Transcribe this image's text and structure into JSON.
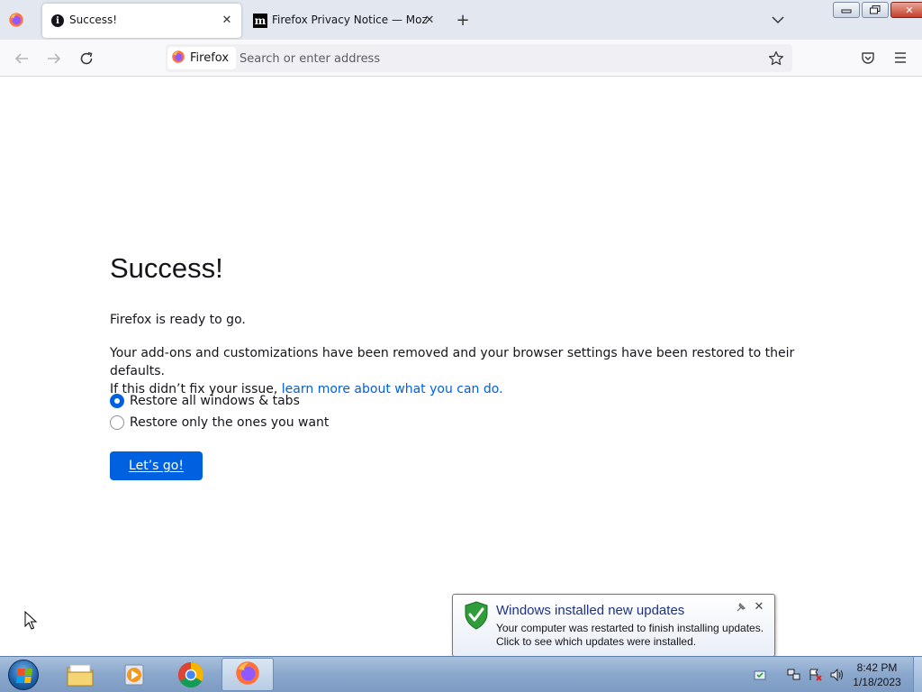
{
  "browser": {
    "tabs": [
      {
        "label": "Success!",
        "favicon": "info-icon",
        "active": true
      },
      {
        "label": "Firefox Privacy Notice — Mozilla",
        "favicon": "mozilla-icon",
        "active": false
      }
    ],
    "identity_label": "Firefox",
    "url_placeholder": "Search or enter address"
  },
  "page": {
    "heading": "Success!",
    "ready_text": "Firefox is ready to go.",
    "description": "Your add-ons and customizations have been removed and your browser settings have been restored to their defaults.",
    "help_prefix": "If this didn’t fix your issue, ",
    "help_link": "learn more about what you can do.",
    "options": [
      {
        "label": "Restore all windows & tabs",
        "checked": true
      },
      {
        "label": "Restore only the ones you want",
        "checked": false
      }
    ],
    "go_button": "Let’s go!"
  },
  "notification": {
    "title": "Windows installed new updates",
    "line1": "Your computer was restarted to finish installing updates.",
    "line2": "Click to see which updates were installed."
  },
  "taskbar": {
    "apps": [
      "explorer-icon",
      "media-player-icon",
      "chrome-icon",
      "firefox-icon"
    ],
    "active_app": "firefox-icon",
    "clock_time": "8:42 PM",
    "clock_date": "1/18/2023"
  },
  "colors": {
    "accent": "#0061e0",
    "link": "#0060df",
    "balloon_title": "#1e3287"
  }
}
